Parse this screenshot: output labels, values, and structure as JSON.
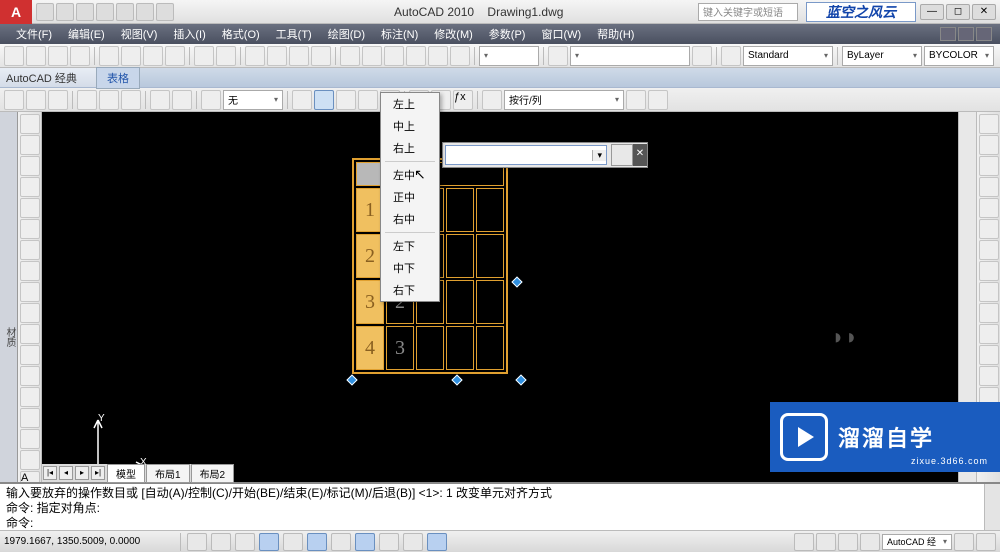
{
  "title": {
    "app": "AutoCAD 2010",
    "file": "Drawing1.dwg"
  },
  "search_placeholder": "键入关键字或短语",
  "brand": "蓝空之风云",
  "menus": [
    "文件(F)",
    "编辑(E)",
    "视图(V)",
    "插入(I)",
    "格式(O)",
    "工具(T)",
    "绘图(D)",
    "标注(N)",
    "修改(M)",
    "参数(P)",
    "窗口(W)",
    "帮助(H)"
  ],
  "workspace": "AutoCAD 经典",
  "ribbon_tab": "表格",
  "combos": {
    "linetype": "无",
    "row_col": "按行/列",
    "style": "Standard",
    "layer_mode": "ByLayer",
    "color": "BYCOLOR"
  },
  "alignment_menu": {
    "items_a": [
      "左上",
      "中上",
      "右上"
    ],
    "items_b": [
      "左中",
      "正中",
      "右中"
    ],
    "items_c": [
      "左下",
      "中下",
      "右下"
    ]
  },
  "table": {
    "row_labels": [
      "1",
      "2",
      "3",
      "4"
    ],
    "inner": [
      "2",
      "3"
    ]
  },
  "model_tabs": {
    "nav": [
      "|◂",
      "◂",
      "▸",
      "▸|"
    ],
    "tabs": [
      "模型",
      "布局1",
      "布局2"
    ]
  },
  "command": {
    "line1": "输入要放弃的操作数目或 [自动(A)/控制(C)/开始(BE)/结束(E)/标记(M)/后退(B)] <1>: 1  改变单元对齐方式",
    "line2": "命令: 指定对角点:",
    "line3": "命令:"
  },
  "status": {
    "coords": "1979.1667, 1350.5009, 0.0000",
    "right_combo": "AutoCAD 经"
  },
  "ucs": {
    "x": "X",
    "y": "Y"
  },
  "watermark": {
    "title": "溜溜自学",
    "url": "zixue.3d66.com"
  }
}
